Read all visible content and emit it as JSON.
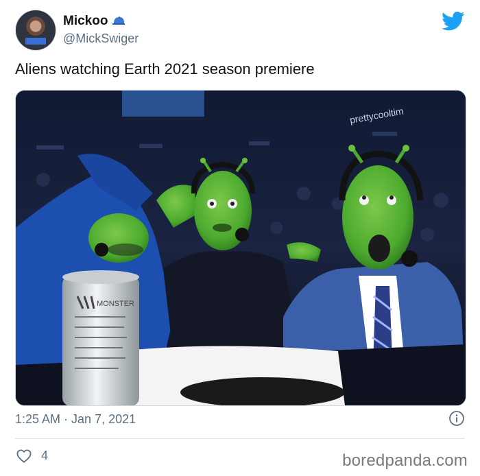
{
  "tweet": {
    "display_name": "Mickoo",
    "handle": "@MickSwiger",
    "text": "Aliens watching Earth 2021 season premiere",
    "timestamp": "1:25 AM · Jan 7, 2021",
    "like_count": "4"
  },
  "media": {
    "watermark_text": "prettycooltim",
    "can_label": "MONSTER"
  },
  "footer": {
    "site_watermark": "boredpanda.com"
  },
  "icons": {
    "verified_cap": "blue-cap-emoji-icon",
    "brand": "twitter-bird-icon",
    "info": "info-icon",
    "like": "heart-icon"
  },
  "colors": {
    "twitter_blue": "#1da1f2",
    "secondary_text": "#5b7083",
    "alien_green": "#4caa2e"
  }
}
